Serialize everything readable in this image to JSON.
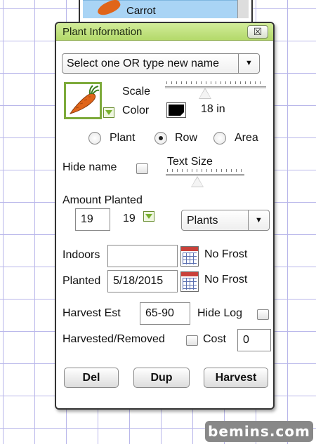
{
  "background_list": {
    "selected_item": "Carrot"
  },
  "dialog": {
    "title": "Plant Information",
    "close_glyph": "☒",
    "name_select": {
      "label": "Select one OR type new name",
      "arrow": "▼"
    },
    "scale": {
      "label": "Scale",
      "level": 0.42
    },
    "color": {
      "label": "Color",
      "value": "#000000"
    },
    "spacing": "18 in",
    "layout": {
      "options": [
        {
          "label": "Plant",
          "selected": false
        },
        {
          "label": "Row",
          "selected": true
        },
        {
          "label": "Area",
          "selected": false
        }
      ]
    },
    "hide_name": {
      "label": "Hide name",
      "checked": false
    },
    "text_size": {
      "label": "Text Size",
      "level": 0.42
    },
    "amount": {
      "label": "Amount Planted",
      "value": "19",
      "computed": "19",
      "unit_select": {
        "label": "Plants",
        "arrow": "▼"
      }
    },
    "indoors": {
      "label": "Indoors",
      "value": "",
      "frost": "No Frost"
    },
    "planted": {
      "label": "Planted",
      "value": "5/18/2015",
      "frost": "No Frost"
    },
    "harvest_est": {
      "label": "Harvest Est",
      "value": "65-90"
    },
    "hide_log": {
      "label": "Hide Log",
      "checked": false
    },
    "harvested": {
      "label": "Harvested/Removed",
      "checked": false
    },
    "cost": {
      "label": "Cost",
      "value": "0"
    },
    "buttons": {
      "del": "Del",
      "dup": "Dup",
      "harvest": "Harvest"
    }
  },
  "watermark": "bemins.com",
  "colors": {
    "titlebar": "#c3e384",
    "grid": "#b9b7ea",
    "plant_frame": "#7daa3a",
    "carrot": "#e0651a"
  }
}
